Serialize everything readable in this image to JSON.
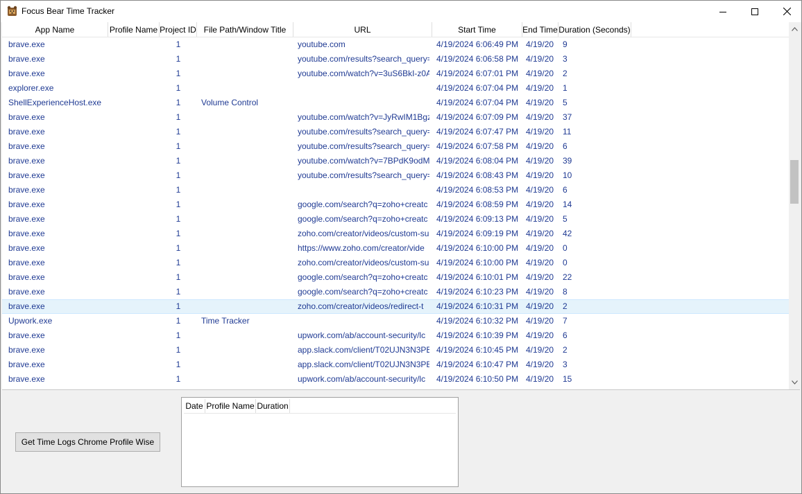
{
  "window": {
    "title": "Focus Bear Time Tracker",
    "icon": "bear-app-icon",
    "controls": {
      "minimize": "minimize-icon",
      "maximize": "maximize-icon",
      "close": "close-icon"
    }
  },
  "log_grid": {
    "columns": [
      "App Name",
      "Profile Name",
      "Project ID",
      "File Path/Window Title",
      "URL",
      "Start Time",
      "End Time",
      "Duration (Seconds)"
    ],
    "selected_row": 18,
    "rows": [
      {
        "app": "brave.exe",
        "profile": "",
        "project": "1",
        "title": "",
        "url": "youtube.com",
        "start": "4/19/2024 6:06:49 PM",
        "end": "4/19/20",
        "duration": "9"
      },
      {
        "app": "brave.exe",
        "profile": "",
        "project": "1",
        "title": "",
        "url": "youtube.com/results?search_query=",
        "start": "4/19/2024 6:06:58 PM",
        "end": "4/19/20",
        "duration": "3"
      },
      {
        "app": "brave.exe",
        "profile": "",
        "project": "1",
        "title": "",
        "url": "youtube.com/watch?v=3uS6BkI-z0A",
        "start": "4/19/2024 6:07:01 PM",
        "end": "4/19/20",
        "duration": "2"
      },
      {
        "app": "explorer.exe",
        "profile": "",
        "project": "1",
        "title": "",
        "url": "",
        "start": "4/19/2024 6:07:04 PM",
        "end": "4/19/20",
        "duration": "1"
      },
      {
        "app": "ShellExperienceHost.exe",
        "profile": "",
        "project": "1",
        "title": "Volume Control",
        "url": "",
        "start": "4/19/2024 6:07:04 PM",
        "end": "4/19/20",
        "duration": "5"
      },
      {
        "app": "brave.exe",
        "profile": "",
        "project": "1",
        "title": "",
        "url": "youtube.com/watch?v=JyRwIM1Bgz",
        "start": "4/19/2024 6:07:09 PM",
        "end": "4/19/20",
        "duration": "37"
      },
      {
        "app": "brave.exe",
        "profile": "",
        "project": "1",
        "title": "",
        "url": "youtube.com/results?search_query=",
        "start": "4/19/2024 6:07:47 PM",
        "end": "4/19/20",
        "duration": "11"
      },
      {
        "app": "brave.exe",
        "profile": "",
        "project": "1",
        "title": "",
        "url": "youtube.com/results?search_query=",
        "start": "4/19/2024 6:07:58 PM",
        "end": "4/19/20",
        "duration": "6"
      },
      {
        "app": "brave.exe",
        "profile": "",
        "project": "1",
        "title": "",
        "url": "youtube.com/watch?v=7BPdK9odM",
        "start": "4/19/2024 6:08:04 PM",
        "end": "4/19/20",
        "duration": "39"
      },
      {
        "app": "brave.exe",
        "profile": "",
        "project": "1",
        "title": "",
        "url": "youtube.com/results?search_query=",
        "start": "4/19/2024 6:08:43 PM",
        "end": "4/19/20",
        "duration": "10"
      },
      {
        "app": "brave.exe",
        "profile": "",
        "project": "1",
        "title": "",
        "url": "",
        "start": "4/19/2024 6:08:53 PM",
        "end": "4/19/20",
        "duration": "6"
      },
      {
        "app": "brave.exe",
        "profile": "",
        "project": "1",
        "title": "",
        "url": "google.com/search?q=zoho+creatc",
        "start": "4/19/2024 6:08:59 PM",
        "end": "4/19/20",
        "duration": "14"
      },
      {
        "app": "brave.exe",
        "profile": "",
        "project": "1",
        "title": "",
        "url": "google.com/search?q=zoho+creatc",
        "start": "4/19/2024 6:09:13 PM",
        "end": "4/19/20",
        "duration": "5"
      },
      {
        "app": "brave.exe",
        "profile": "",
        "project": "1",
        "title": "",
        "url": "zoho.com/creator/videos/custom-su",
        "start": "4/19/2024 6:09:19 PM",
        "end": "4/19/20",
        "duration": "42"
      },
      {
        "app": "brave.exe",
        "profile": "",
        "project": "1",
        "title": "",
        "url": "https://www.zoho.com/creator/vide",
        "start": "4/19/2024 6:10:00 PM",
        "end": "4/19/20",
        "duration": "0"
      },
      {
        "app": "brave.exe",
        "profile": "",
        "project": "1",
        "title": "",
        "url": "zoho.com/creator/videos/custom-su",
        "start": "4/19/2024 6:10:00 PM",
        "end": "4/19/20",
        "duration": "0"
      },
      {
        "app": "brave.exe",
        "profile": "",
        "project": "1",
        "title": "",
        "url": "google.com/search?q=zoho+creatc",
        "start": "4/19/2024 6:10:01 PM",
        "end": "4/19/20",
        "duration": "22"
      },
      {
        "app": "brave.exe",
        "profile": "",
        "project": "1",
        "title": "",
        "url": "google.com/search?q=zoho+creatc",
        "start": "4/19/2024 6:10:23 PM",
        "end": "4/19/20",
        "duration": "8"
      },
      {
        "app": "brave.exe",
        "profile": "",
        "project": "1",
        "title": "",
        "url": "zoho.com/creator/videos/redirect-t",
        "start": "4/19/2024 6:10:31 PM",
        "end": "4/19/20",
        "duration": "2"
      },
      {
        "app": "Upwork.exe",
        "profile": "",
        "project": "1",
        "title": "Time Tracker",
        "url": "",
        "start": "4/19/2024 6:10:32 PM",
        "end": "4/19/20",
        "duration": "7"
      },
      {
        "app": "brave.exe",
        "profile": "",
        "project": "1",
        "title": "",
        "url": "upwork.com/ab/account-security/lc",
        "start": "4/19/2024 6:10:39 PM",
        "end": "4/19/20",
        "duration": "6"
      },
      {
        "app": "brave.exe",
        "profile": "",
        "project": "1",
        "title": "",
        "url": "app.slack.com/client/T02UJN3N3PB",
        "start": "4/19/2024 6:10:45 PM",
        "end": "4/19/20",
        "duration": "2"
      },
      {
        "app": "brave.exe",
        "profile": "",
        "project": "1",
        "title": "",
        "url": "app.slack.com/client/T02UJN3N3PB",
        "start": "4/19/2024 6:10:47 PM",
        "end": "4/19/20",
        "duration": "3"
      },
      {
        "app": "brave.exe",
        "profile": "",
        "project": "1",
        "title": "",
        "url": "upwork.com/ab/account-security/lc",
        "start": "4/19/2024 6:10:50 PM",
        "end": "4/19/20",
        "duration": "15"
      }
    ]
  },
  "action": {
    "button_label": "Get Time Logs Chrome Profile Wise"
  },
  "profile_grid": {
    "columns": [
      "Date",
      "Profile Name",
      "Duration"
    ]
  },
  "colors": {
    "cell_text": "#1f3a93",
    "selected_row": "#e5f3fb"
  }
}
